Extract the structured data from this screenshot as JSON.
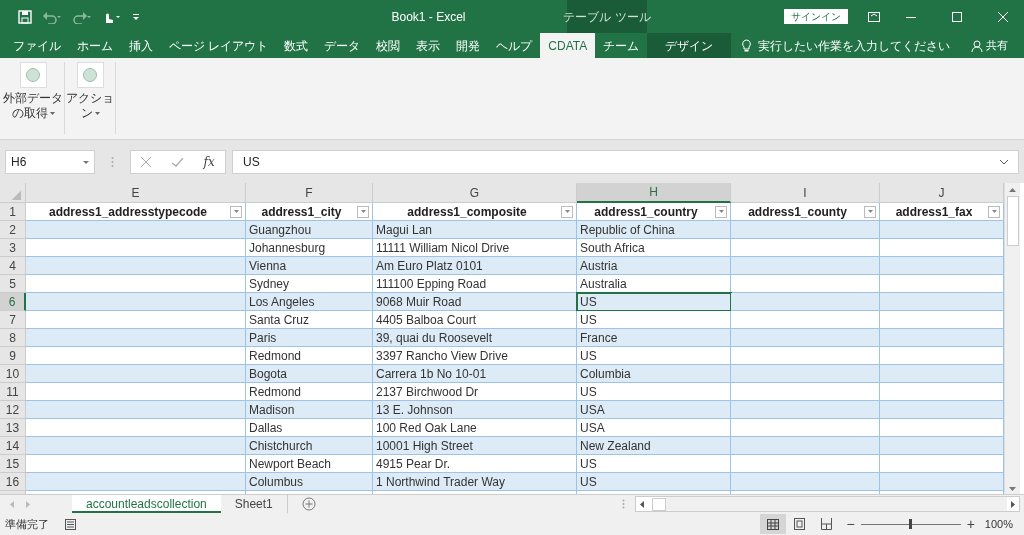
{
  "title_bar": {
    "title": "Book1  -  Excel",
    "contextual_label": "テーブル ツール",
    "signin": "サインイン"
  },
  "ribbon_tabs": [
    {
      "label": "ファイル",
      "selected": false,
      "kind": "normal"
    },
    {
      "label": "ホーム",
      "selected": false,
      "kind": "normal"
    },
    {
      "label": "挿入",
      "selected": false,
      "kind": "normal"
    },
    {
      "label": "ページ レイアウト",
      "selected": false,
      "kind": "normal"
    },
    {
      "label": "数式",
      "selected": false,
      "kind": "normal"
    },
    {
      "label": "データ",
      "selected": false,
      "kind": "normal"
    },
    {
      "label": "校閲",
      "selected": false,
      "kind": "normal"
    },
    {
      "label": "表示",
      "selected": false,
      "kind": "normal"
    },
    {
      "label": "開発",
      "selected": false,
      "kind": "normal"
    },
    {
      "label": "ヘルプ",
      "selected": false,
      "kind": "normal"
    },
    {
      "label": "CDATA",
      "selected": true,
      "kind": "normal"
    },
    {
      "label": "チーム",
      "selected": false,
      "kind": "normal"
    },
    {
      "label": "デザイン",
      "selected": false,
      "kind": "contextual"
    }
  ],
  "tell_me": "実行したい作業を入力してください",
  "share": "共有",
  "ribbon_buttons": [
    {
      "lines": [
        "外部データ",
        "の取得"
      ]
    },
    {
      "lines": [
        "アクショ",
        "ン"
      ]
    }
  ],
  "formula_bar": {
    "name_box": "H6",
    "fx": "fx",
    "value": "US"
  },
  "columns": [
    {
      "letter": "E",
      "header": "address1_addresstypecode",
      "selected": false
    },
    {
      "letter": "F",
      "header": "address1_city",
      "selected": false
    },
    {
      "letter": "G",
      "header": "address1_composite",
      "selected": false
    },
    {
      "letter": "H",
      "header": "address1_country",
      "selected": true
    },
    {
      "letter": "I",
      "header": "address1_county",
      "selected": false
    },
    {
      "letter": "J",
      "header": "address1_fax",
      "selected": false
    }
  ],
  "header_row_number": "1",
  "rows": [
    {
      "number": "2",
      "selected": false,
      "cells": [
        null,
        "Guangzhou",
        "Magui Lan",
        "Republic of China",
        null,
        null
      ]
    },
    {
      "number": "3",
      "selected": false,
      "cells": [
        null,
        "Johannesburg",
        "11111 William Nicol Drive",
        "South Africa",
        null,
        null
      ]
    },
    {
      "number": "4",
      "selected": false,
      "cells": [
        null,
        "Vienna",
        "Am Euro Platz 0101",
        "Austria",
        null,
        null
      ]
    },
    {
      "number": "5",
      "selected": false,
      "cells": [
        null,
        "Sydney",
        "111100 Epping Road",
        "Australia",
        null,
        null
      ]
    },
    {
      "number": "6",
      "selected": true,
      "cells": [
        null,
        "Los Angeles",
        "9068 Muir Road",
        "US",
        null,
        null
      ]
    },
    {
      "number": "7",
      "selected": false,
      "cells": [
        null,
        "Santa Cruz",
        "4405 Balboa Court",
        "US",
        null,
        null
      ]
    },
    {
      "number": "8",
      "selected": false,
      "cells": [
        null,
        "Paris",
        "39, quai du Roosevelt",
        "France",
        null,
        null
      ]
    },
    {
      "number": "9",
      "selected": false,
      "cells": [
        null,
        "Redmond",
        "3397 Rancho View Drive",
        "US",
        null,
        null
      ]
    },
    {
      "number": "10",
      "selected": false,
      "cells": [
        null,
        "Bogota",
        "Carrera 1b No 10-01",
        "Columbia",
        null,
        null
      ]
    },
    {
      "number": "11",
      "selected": false,
      "cells": [
        null,
        "Redmond",
        "2137 Birchwood Dr",
        "US",
        null,
        null
      ]
    },
    {
      "number": "12",
      "selected": false,
      "cells": [
        null,
        "Madison",
        "13 E. Johnson",
        "USA",
        null,
        null
      ]
    },
    {
      "number": "13",
      "selected": false,
      "cells": [
        null,
        "Dallas",
        "100 Red Oak Lane",
        "USA",
        null,
        null
      ]
    },
    {
      "number": "14",
      "selected": false,
      "cells": [
        null,
        "Chistchurch",
        "10001 High Street",
        "New Zealand",
        null,
        null
      ]
    },
    {
      "number": "15",
      "selected": false,
      "cells": [
        null,
        "Newport Beach",
        "4915 Pear Dr.",
        "US",
        null,
        null
      ]
    },
    {
      "number": "16",
      "selected": false,
      "cells": [
        null,
        "Columbus",
        "1 Northwind Trader Way",
        "US",
        null,
        null
      ]
    }
  ],
  "sheet_tabs": [
    {
      "label": "accountleadscollection",
      "selected": true
    },
    {
      "label": "Sheet1",
      "selected": false
    }
  ],
  "status_bar": {
    "text": "準備完了",
    "zoom_out": "−",
    "zoom_in": "+",
    "zoom": "100%",
    "zoom_slider": {
      "level": 0.5
    }
  }
}
